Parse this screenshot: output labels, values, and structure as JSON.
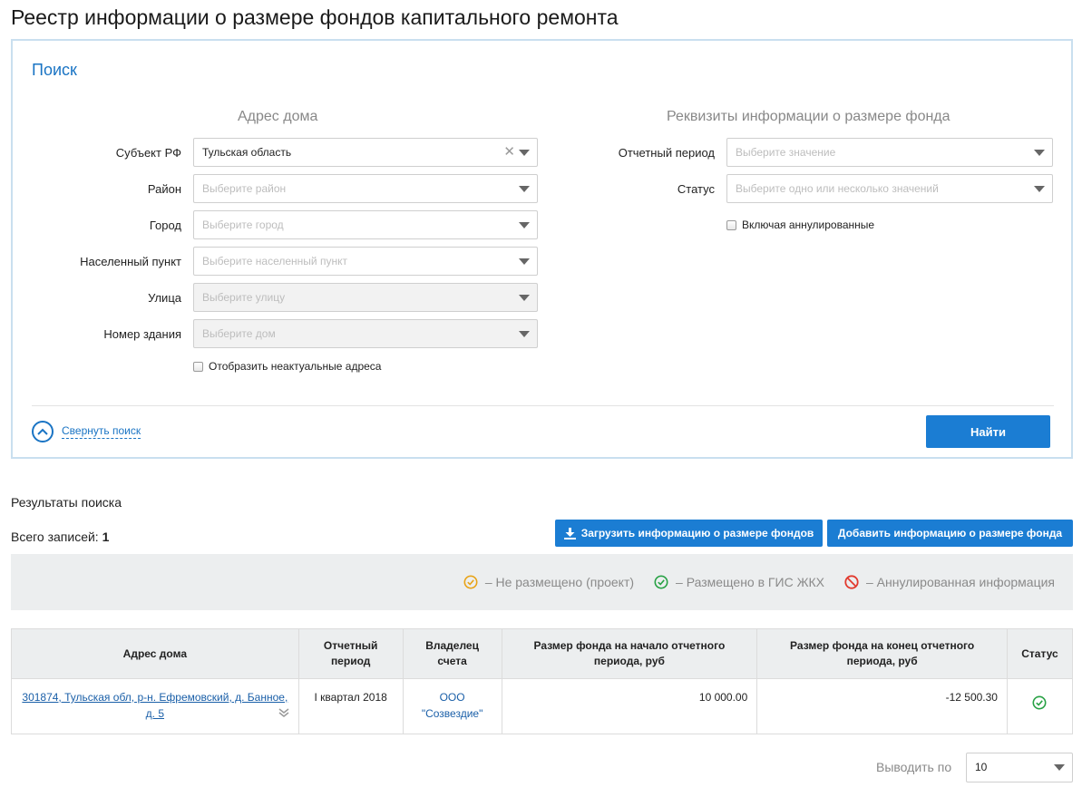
{
  "page": {
    "title": "Реестр информации о размере фондов капитального ремонта"
  },
  "search": {
    "heading": "Поиск",
    "address_title": "Адрес дома",
    "requisites_title": "Реквизиты информации о размере фонда",
    "fields": {
      "subject": {
        "label": "Субъект РФ",
        "value": "Тульская область"
      },
      "district": {
        "label": "Район",
        "placeholder": "Выберите район"
      },
      "city": {
        "label": "Город",
        "placeholder": "Выберите город"
      },
      "settlement": {
        "label": "Населенный пункт",
        "placeholder": "Выберите населенный пункт"
      },
      "street": {
        "label": "Улица",
        "placeholder": "Выберите улицу"
      },
      "building": {
        "label": "Номер здания",
        "placeholder": "Выберите дом"
      },
      "period": {
        "label": "Отчетный период",
        "placeholder": "Выберите значение"
      },
      "status": {
        "label": "Статус",
        "placeholder": "Выберите одно или несколько значений"
      }
    },
    "show_outdated_label": "Отобразить неактуальные адреса",
    "include_annulled_label": "Включая аннулированные",
    "collapse_label": "Свернуть поиск",
    "find_label": "Найти"
  },
  "results": {
    "title": "Результаты поиска",
    "total_label": "Всего записей:",
    "total_count": "1",
    "upload_label": "Загрузить информацию о размере фондов",
    "add_label": "Добавить информацию о размере фонда",
    "legend": [
      {
        "icon": "check-circle-icon",
        "color": "#e8a317",
        "text": "– Не размещено (проект)"
      },
      {
        "icon": "check-circle-icon",
        "color": "#27a144",
        "text": "– Размещено в ГИС ЖКХ"
      },
      {
        "icon": "ban-icon",
        "color": "#e23a2e",
        "text": "– Аннулированная информация"
      }
    ],
    "columns": {
      "address": "Адрес дома",
      "period": "Отчетный период",
      "owner": "Владелец счета",
      "start": "Размер фонда на начало отчетного периода, руб",
      "end": "Размер фонда на конец отчетного периода, руб",
      "status": "Статус"
    },
    "rows": [
      {
        "address": "301874, Тульская обл, р-н. Ефремовский, д. Банное, д. 5",
        "period": "I квартал 2018",
        "owner": "ООО \"Созвездие\"",
        "start": "10 000.00",
        "end": "-12 500.30",
        "status_icon": "check-circle-icon",
        "status_color": "#27a144"
      }
    ],
    "page_size_label": "Выводить по",
    "page_size_value": "10"
  }
}
